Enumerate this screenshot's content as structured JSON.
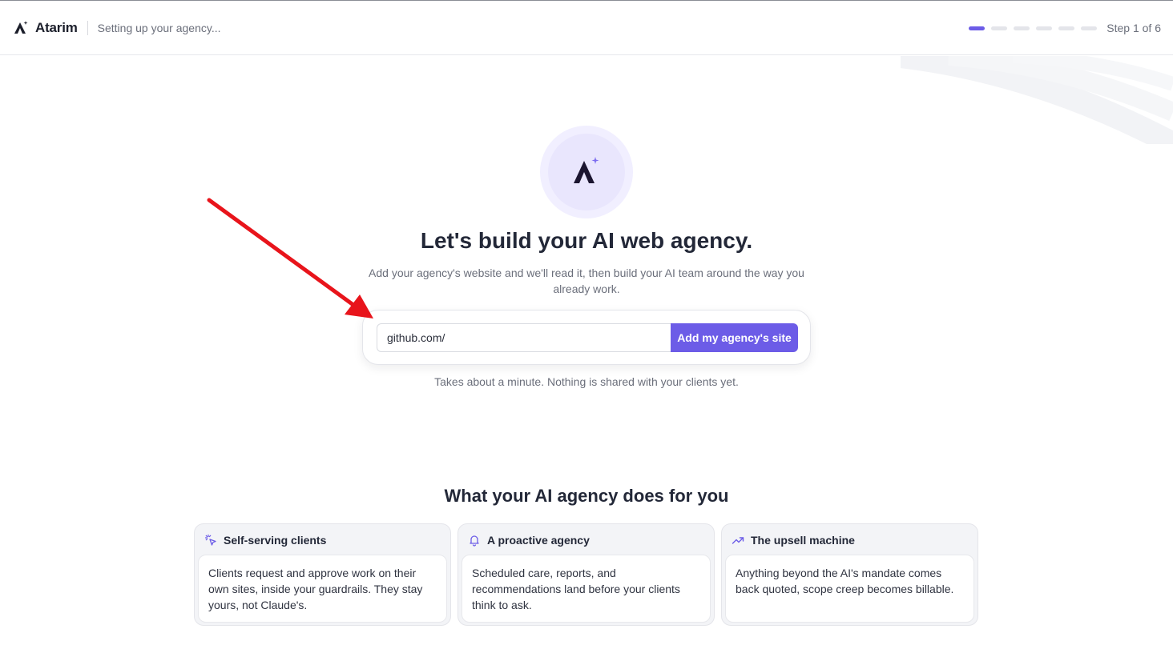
{
  "header": {
    "brand": "Atarim",
    "subtitle": "Setting up your agency...",
    "step_text": "Step 1 of 6",
    "steps_total": 6,
    "steps_current": 1
  },
  "hero": {
    "title": "Let's build your AI web agency.",
    "description": "Add your agency's website and we'll read it, then build your AI team around the way you already work.",
    "input_value": "github.com/",
    "button_label": "Add my agency's site",
    "note": "Takes about a minute. Nothing is shared with your clients yet."
  },
  "features": {
    "title": "What your AI agency does for you",
    "cards": [
      {
        "icon": "pointer-click-icon",
        "title": "Self-serving clients",
        "body": "Clients request and approve work on their own sites, inside your guardrails. They stay yours, not Claude's."
      },
      {
        "icon": "bell-icon",
        "title": "A proactive agency",
        "body": "Scheduled care, reports, and recommendations land before your clients think to ask."
      },
      {
        "icon": "trending-up-icon",
        "title": "The upsell machine",
        "body": "Anything beyond the AI's mandate comes back quoted, scope creep becomes billable."
      }
    ]
  },
  "colors": {
    "accent": "#6c5ce7",
    "annotation_arrow": "#e8141b"
  }
}
